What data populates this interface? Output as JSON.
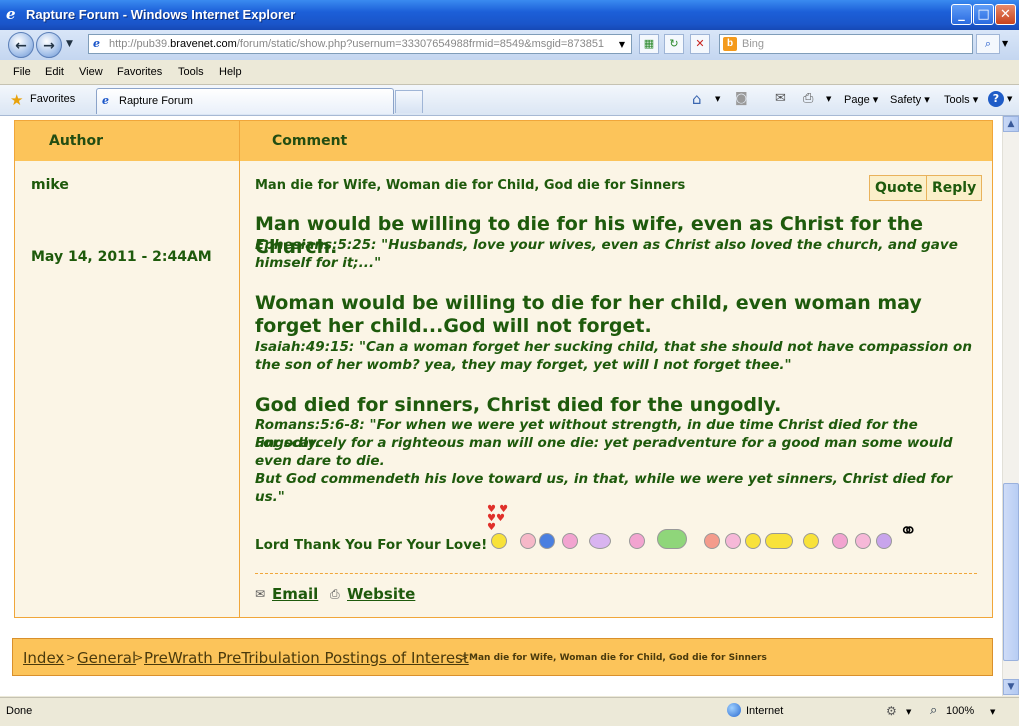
{
  "window": {
    "title": "Rapture Forum - Windows Internet Explorer"
  },
  "nav": {
    "url_prefix": "http://pub39.",
    "url_host": "bravenet.com",
    "url_rest": "/forum/static/show.php?usernum=33307654988frmid=8549&msgid=873851",
    "search_placeholder": "Bing"
  },
  "menu": [
    "File",
    "Edit",
    "View",
    "Favorites",
    "Tools",
    "Help"
  ],
  "favorites_label": "Favorites",
  "tab_label": "Rapture Forum",
  "commands": {
    "page": "Page",
    "safety": "Safety",
    "tools": "Tools"
  },
  "forum": {
    "header_author": "Author",
    "header_comment": "Comment",
    "author": "mike",
    "date": "May 14, 2011 - 2:44AM",
    "subject": "Man die for Wife, Woman die for Child, God die for Sinners",
    "quote_label": "Quote",
    "reply_label": "Reply",
    "heading1": "Man would be willing to die for his wife, even as Christ for the Church.",
    "verse1": "Ephesians:5:25: \"Husbands, love your wives, even as Christ also loved the church, and gave himself for it;...\"",
    "heading2": "Woman would be willing to die for her child, even woman may forget her child...God will not forget.",
    "verse2": "Isaiah:49:15: \"Can a woman forget her sucking child, that she should not have compassion on the son of her womb? yea, they may forget, yet will I not forget thee.\"",
    "heading3": "God died for sinners, Christ died for the ungodly.",
    "verse3a": "Romans:5:6-8: \"For when we were yet without strength, in due time Christ died for the ungodly.",
    "verse3b": "For scarcely for a righteous man will one die: yet peradventure for a good man some would even dare to die.",
    "verse3c": "But God commendeth his love toward us, in that, while we were yet sinners, Christ died for us.\"",
    "love_line": "Lord Thank You For Your Love!",
    "email_label": "Email",
    "website_label": "Website"
  },
  "breadcrumb": {
    "index": "Index",
    "general": "General",
    "forum": "PreWrath PreTribulation Postings of Interest",
    "current": "Man die for Wife, Woman die for Child, God die for Sinners",
    "separator": ">"
  },
  "status": {
    "left": "Done",
    "zone": "Internet",
    "zoom": "100%"
  },
  "colors": {
    "accent": "#fcc45a",
    "text_green": "#1e5a0c",
    "border": "#f0a63a"
  }
}
